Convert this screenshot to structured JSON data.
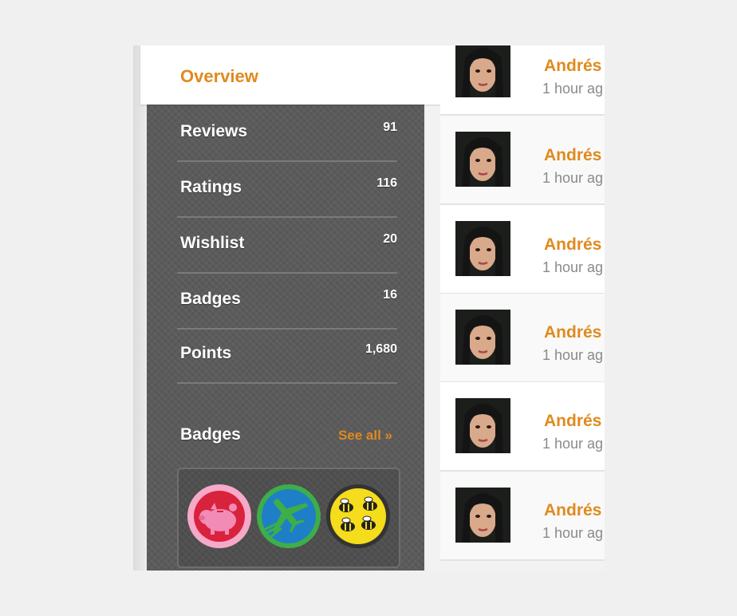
{
  "sidebar": {
    "overview_tab": "Overview",
    "stats": [
      {
        "label": "Reviews",
        "count": "91"
      },
      {
        "label": "Ratings",
        "count": "116"
      },
      {
        "label": "Wishlist",
        "count": "20"
      },
      {
        "label": "Badges",
        "count": "16"
      },
      {
        "label": "Points",
        "count": "1,680"
      }
    ],
    "badges_section": {
      "title": "Badges",
      "see_all": "See all »",
      "items": [
        {
          "icon": "piggy-bank-badge-icon",
          "color": "#f28bb5",
          "ring": "#f7a9c9"
        },
        {
          "icon": "airplane-badge-icon",
          "color": "#1f7fc6",
          "ring": "#3dae49"
        },
        {
          "icon": "bees-badge-icon",
          "color": "#f5dc1c",
          "ring": "#333333"
        }
      ]
    }
  },
  "feed": {
    "items": [
      {
        "name": "Andrés",
        "time": "1 hour ag"
      },
      {
        "name": "Andrés",
        "time": "1 hour ag"
      },
      {
        "name": "Andrés",
        "time": "1 hour ag"
      },
      {
        "name": "Andrés",
        "time": "1 hour ag"
      },
      {
        "name": "Andrés",
        "time": "1 hour ag"
      },
      {
        "name": "Andrés",
        "time": "1 hour ag"
      }
    ]
  },
  "colors": {
    "accent": "#e08a1e",
    "panel": "#5b5b5b"
  }
}
